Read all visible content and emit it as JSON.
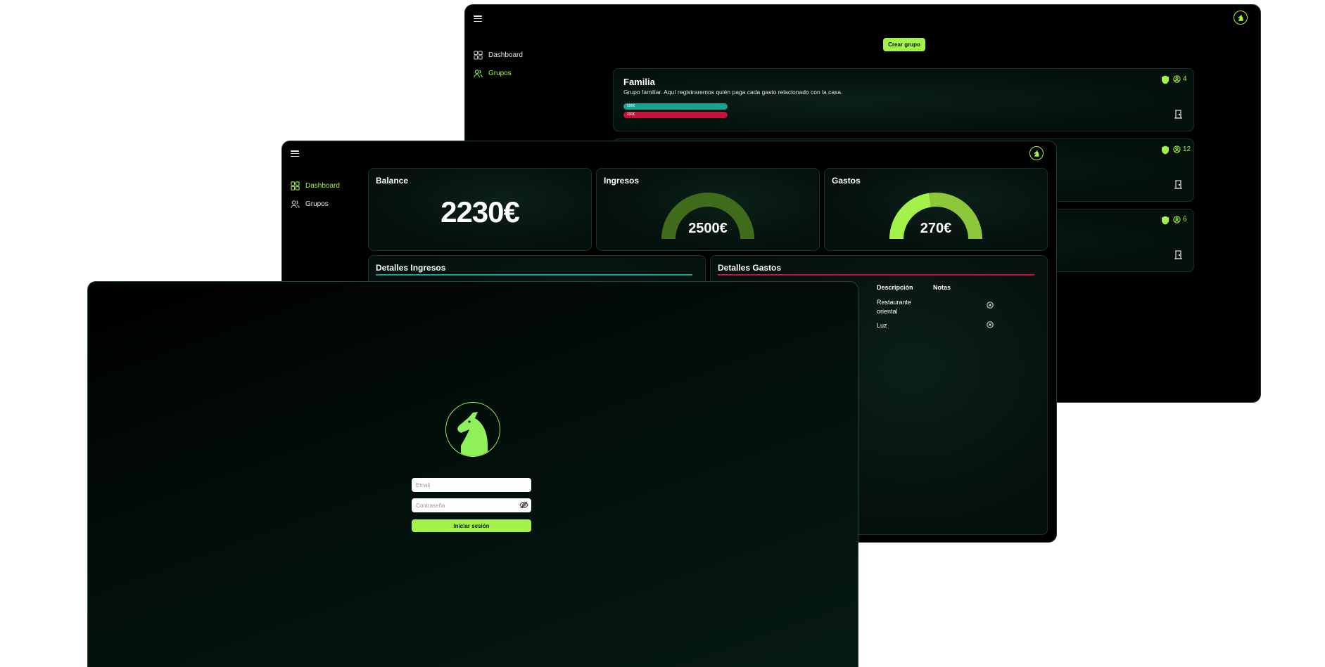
{
  "colors": {
    "accent": "#a3f24a",
    "income": "#16a394",
    "expense": "#c8103e",
    "ingresos_gauge": "#3f6b1a",
    "gastos_gauge_dark": "#8cc83a",
    "gastos_gauge_light": "#a3f24a"
  },
  "groups_window": {
    "nav": {
      "dashboard": "Dashboard",
      "grupos": "Grupos"
    },
    "create_button": "Crear grupo",
    "groups": [
      {
        "name": "Familia",
        "description": "Grupo familiar. Aquí registraremos quién paga cada gasto relacionado con la casa.",
        "members": "4",
        "income_bar": "500€",
        "expense_bar": "200€"
      },
      {
        "members": "12"
      },
      {
        "members": "6"
      }
    ]
  },
  "dashboard_window": {
    "nav": {
      "dashboard": "Dashboard",
      "grupos": "Grupos"
    },
    "balance": {
      "title": "Balance",
      "value": "2230€"
    },
    "ingresos": {
      "title": "Ingresos",
      "value": "2500€",
      "fill": 1.0
    },
    "gastos": {
      "title": "Gastos",
      "value": "270€",
      "fill": 0.45
    },
    "detalles_ingresos": {
      "title": "Detalles Ingresos"
    },
    "detalles_gastos": {
      "title": "Detalles Gastos",
      "columns": [
        "Descripción",
        "Notas"
      ],
      "rows": [
        {
          "descripcion": "Restaurante oriental"
        },
        {
          "descripcion": "Luz"
        }
      ]
    }
  },
  "login_window": {
    "email_placeholder": "Email",
    "password_placeholder": "Contraseña",
    "login_button": "Iniciar sesión"
  }
}
